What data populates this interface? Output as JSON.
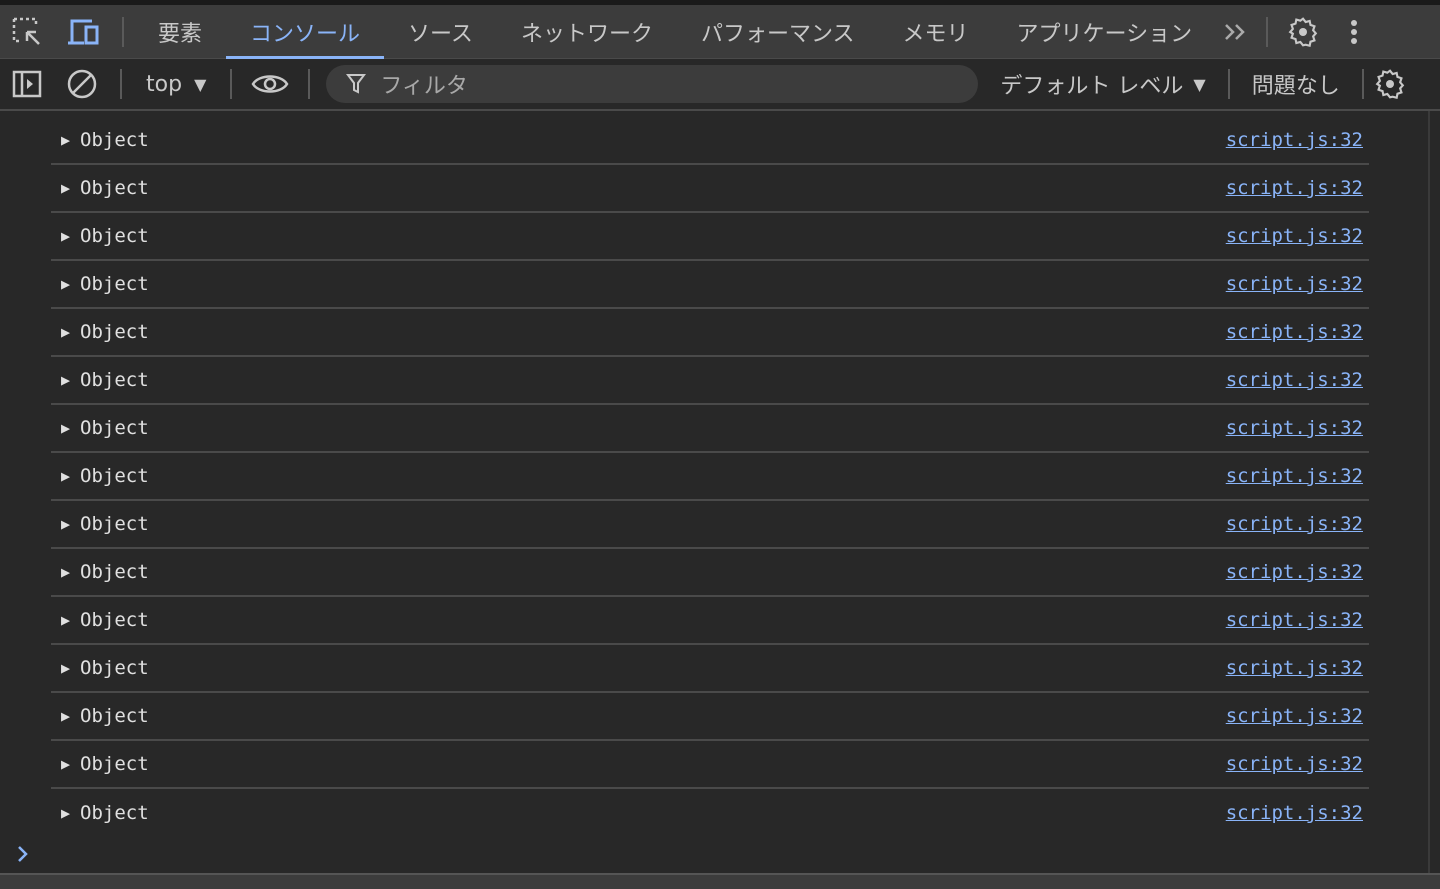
{
  "tabs": [
    {
      "label": "要素"
    },
    {
      "label": "コンソール",
      "active": true
    },
    {
      "label": "ソース"
    },
    {
      "label": "ネットワーク"
    },
    {
      "label": "パフォーマンス"
    },
    {
      "label": "メモリ"
    },
    {
      "label": "アプリケーション"
    }
  ],
  "toolbar": {
    "context": "top",
    "filter_placeholder": "フィルタ",
    "levels": "デフォルト レベル",
    "issues": "問題なし"
  },
  "colors": {
    "accent": "#8ab4f8",
    "background": "#282828",
    "tabbar": "#3c3c3c"
  },
  "rows": [
    {
      "text": "Object",
      "source": "script.js:32"
    },
    {
      "text": "Object",
      "source": "script.js:32"
    },
    {
      "text": "Object",
      "source": "script.js:32"
    },
    {
      "text": "Object",
      "source": "script.js:32"
    },
    {
      "text": "Object",
      "source": "script.js:32"
    },
    {
      "text": "Object",
      "source": "script.js:32"
    },
    {
      "text": "Object",
      "source": "script.js:32"
    },
    {
      "text": "Object",
      "source": "script.js:32"
    },
    {
      "text": "Object",
      "source": "script.js:32"
    },
    {
      "text": "Object",
      "source": "script.js:32"
    },
    {
      "text": "Object",
      "source": "script.js:32"
    },
    {
      "text": "Object",
      "source": "script.js:32"
    },
    {
      "text": "Object",
      "source": "script.js:32"
    },
    {
      "text": "Object",
      "source": "script.js:32"
    },
    {
      "text": "Object",
      "source": "script.js:32"
    }
  ]
}
